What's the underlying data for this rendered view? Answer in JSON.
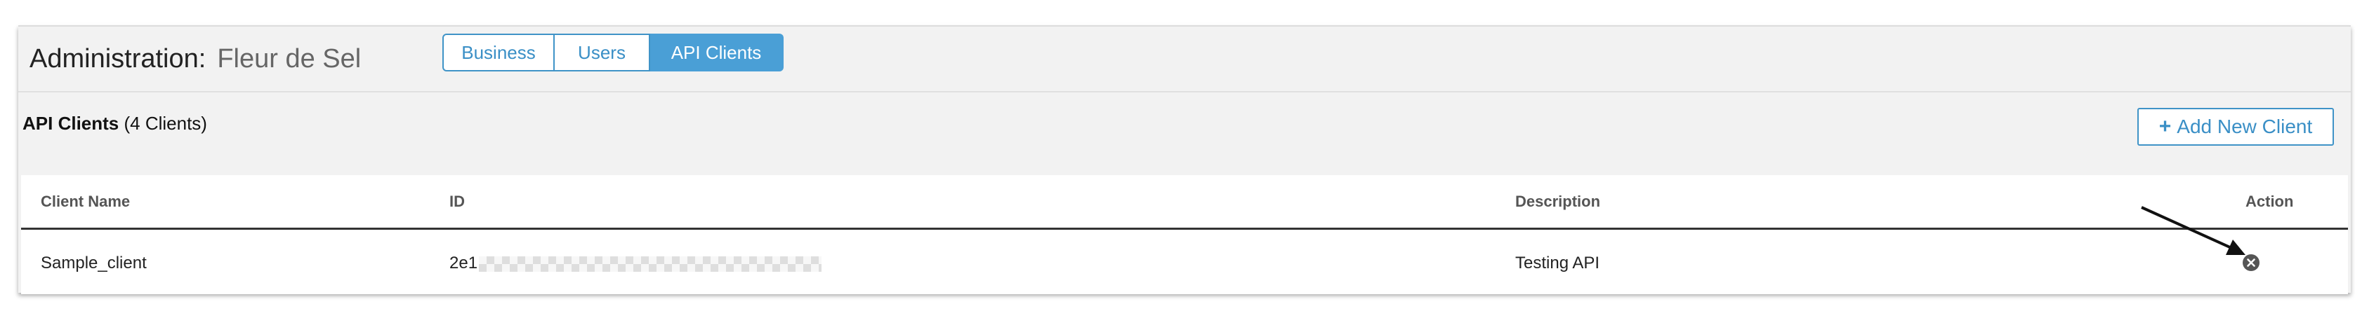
{
  "header": {
    "title": "Administration:",
    "business_name": "Fleur de Sel"
  },
  "tabs": [
    {
      "label": "Business",
      "active": false
    },
    {
      "label": "Users",
      "active": false
    },
    {
      "label": "API Clients",
      "active": true
    }
  ],
  "section": {
    "title": "API Clients",
    "count_text": "(4 Clients)",
    "add_button_label": "Add New Client",
    "add_button_icon": "plus-icon"
  },
  "table": {
    "columns": [
      "Client Name",
      "ID",
      "Description",
      "Action"
    ],
    "rows": [
      {
        "client_name": "Sample_client",
        "id_visible": "2e1",
        "id_redacted": true,
        "description": "Testing API",
        "action_icon": "delete-circle-icon"
      }
    ]
  },
  "annotations": {
    "arrow_target": "delete-client-button",
    "arrow_color": "#111111"
  },
  "colors": {
    "accent": "#4a9fd6",
    "accent_border": "#3f93c7",
    "panel_bg": "#f2f2f2",
    "table_header_rule": "#333333"
  }
}
